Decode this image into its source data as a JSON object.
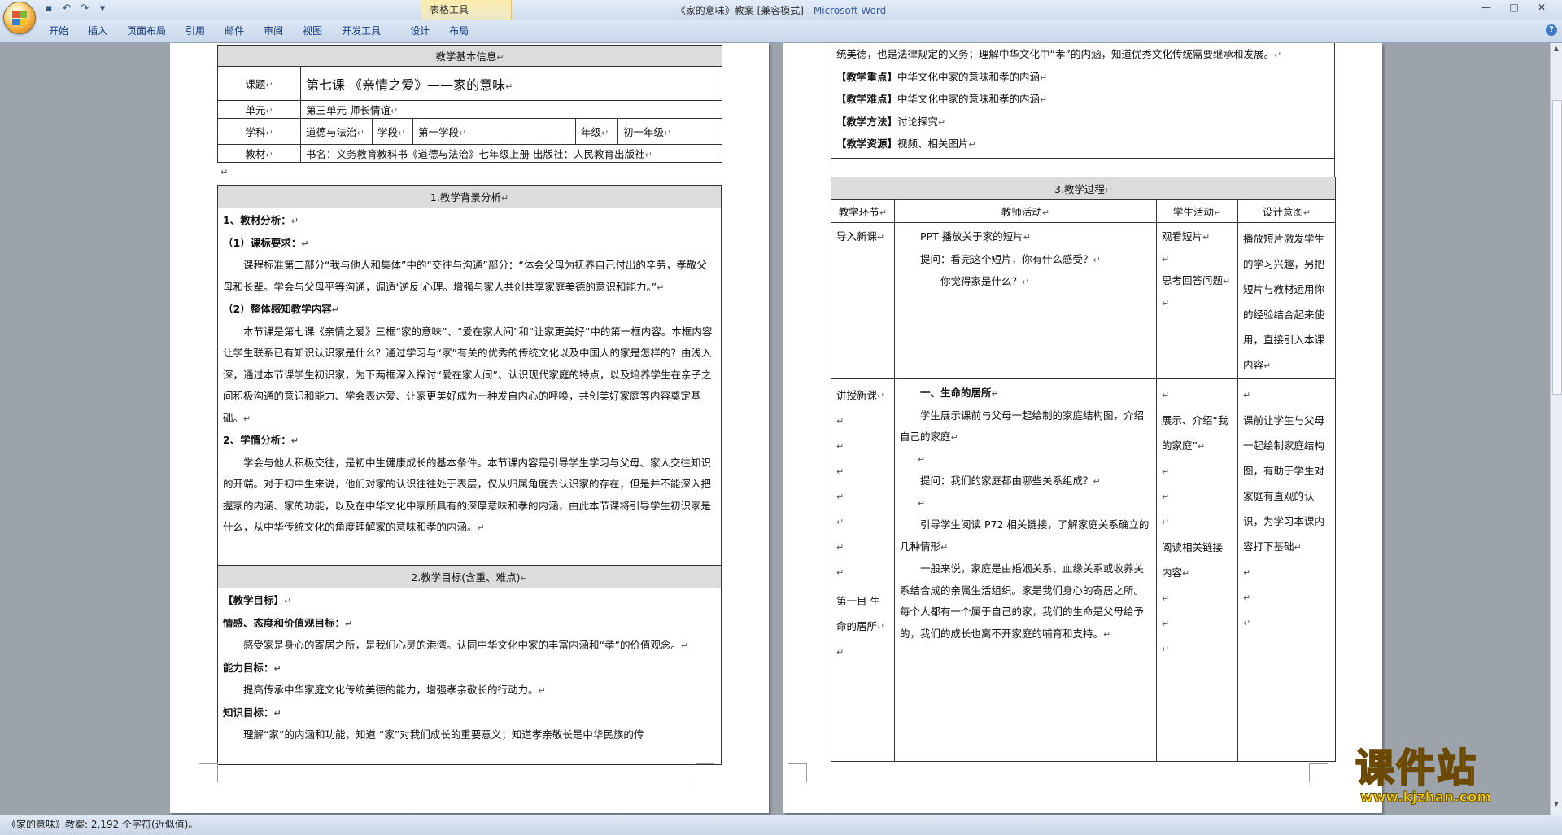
{
  "window": {
    "title_doc": "《家的意味》教案 [兼容模式] - ",
    "title_app": "Microsoft Word",
    "context_tools": "表格工具",
    "min": "—",
    "max": "□",
    "close": "✕"
  },
  "ribbon": {
    "tabs": [
      "开始",
      "插入",
      "页面布局",
      "引用",
      "邮件",
      "审阅",
      "视图",
      "开发工具",
      "设计",
      "布局"
    ],
    "help": "?"
  },
  "pm": "↵",
  "info_table": {
    "header": "教学基本信息",
    "topic_label": "课题",
    "topic_value": "第七课  《亲情之爱》——家的意味",
    "unit_label": "单元",
    "unit_value": "第三单元  师长情谊",
    "subject_label": "学科",
    "subject_value": "道德与法治",
    "stage_label": "学段",
    "stage_value": "第一学段",
    "grade_label": "年级",
    "grade_value": "初一年级",
    "textbook_label": "教材",
    "textbook_value": "书名：义务教育教科书《道德与法治》七年级上册     出版社：人民教育出版社"
  },
  "background": {
    "header": "1.教学背景分析",
    "h1": "1、教材分析：",
    "h1a": "（1）课标要求：",
    "p1": "课程标准第二部分“我与他人和集体”中的“交往与沟通”部分：“体会父母为抚养自己付出的辛劳，孝敬父母和长辈。学会与父母平等沟通，调适‘逆反’心理。增强与家人共创共享家庭美德的意识和能力。”",
    "h1b": "（2）整体感知教学内容",
    "p2": "本节课是第七课《亲情之爱》三框“家的意味”、“爱在家人间”和“让家更美好”中的第一框内容。本框内容让学生联系已有知识认识家是什么？通过学习与“家”有关的优秀的传统文化以及中国人的家是怎样的？由浅入深，通过本节课学生初识家，为下两框深入探讨“爱在家人间”、认识现代家庭的特点，以及培养学生在亲子之间积极沟通的意识和能力、学会表达爱、让家更美好成为一种发自内心的呼唤，共创美好家庭等内容奠定基础。",
    "h2": "2、学情分析：",
    "p3": "学会与他人积极交往，是初中生健康成长的基本条件。本节课内容是引导学生学习与父母、家人交往知识的开端。对于初中生来说，他们对家的认识往往处于表层，仅从归属角度去认识家的存在，但是并不能深入把握家的内涵、家的功能，以及在中华文化中家所具有的深厚意味和孝的内涵，由此本节课将引导学生初识家是什么，从中华传统文化的角度理解家的意味和孝的内涵。"
  },
  "goals": {
    "header": "2.教学目标(含重、难点)",
    "title": "【教学目标】",
    "emo_label": "情感、态度和价值观目标：",
    "emo_text": "感受家是身心的寄居之所，是我们心灵的港湾。认同中华文化中家的丰富内涵和“孝”的价值观念。",
    "ability_label": "能力目标：",
    "ability_text": "提高传承中华家庭文化传统美德的能力，增强孝亲敬长的行动力。",
    "knowledge_label": "知识目标：",
    "knowledge_text": "理解“家”的内涵和功能，知道  “家”对我们成长的重要意义；知道孝亲敬长是中华民族的传"
  },
  "page2_top": {
    "cont": "统美德，也是法律规定的义务；理解中华文化中“孝”的内涵，知道优秀文化传统需要继承和发展。",
    "key_label": "【教学重点】",
    "key_text": "中华文化中家的意味和孝的内涵",
    "diff_label": "【教学难点】",
    "diff_text": "中华文化中家的意味和孝的内涵",
    "method_label": "【教学方法】",
    "method_text": "讨论探究",
    "res_label": "【教学资源】",
    "res_text": "视频、相关图片"
  },
  "process": {
    "header": "3.教学过程",
    "col1": "教学环节",
    "col2": "教师活动",
    "col3": "学生活动",
    "col4": "设计意图",
    "r1_stage": "导入新课",
    "r1_t1": "PPT 播放关于家的短片",
    "r1_t2": "提问：看完这个短片，你有什么感受？",
    "r1_t3": "你觉得家是什么？",
    "r1_s1": "观看短片",
    "r1_s2": "思考回答问题",
    "r1_d": "播放短片激发学生的学习兴趣，另把短片与教材运用你的经验结合起来使用，直接引入本课内容",
    "r2_stage": "讲授新课",
    "r2_stage2": "第一目  生命的居所",
    "r2_head": "一、生命的居所",
    "r2_t1": "学生展示课前与父母一起绘制的家庭结构图，介绍自己的家庭",
    "r2_t2": "提问：我们的家庭都由哪些关系组成？",
    "r2_t3": "引导学生阅读 P72 相关链接，了解家庭关系确立的几种情形",
    "r2_t4": "一般来说，家庭是由婚姻关系、血缘关系或收养关系结合成的亲属生活组织。家是我们身心的寄居之所。每个人都有一个属于自己的家，我们的生命是父母给予的，我们的成长也离不开家庭的哺育和支持。",
    "r2_s1": "展示、介绍“我的家庭”",
    "r2_s2": "阅读相关链接内容",
    "r2_d": "课前让学生与父母一起绘制家庭结构图，有助于学生对家庭有直观的认识，为学习本课内容打下基础"
  },
  "status": {
    "text": "《家的意味》教案: 2,192 个字符(近似值)。"
  },
  "watermark": {
    "main": "课件站",
    "url": "www.kjzhan.com"
  },
  "colors": {
    "office_orange": "#f0a534",
    "ribbon_blue": "#dde8f5",
    "table_header": "#dcdcdc",
    "watermark_yellow": "#f5d400"
  }
}
